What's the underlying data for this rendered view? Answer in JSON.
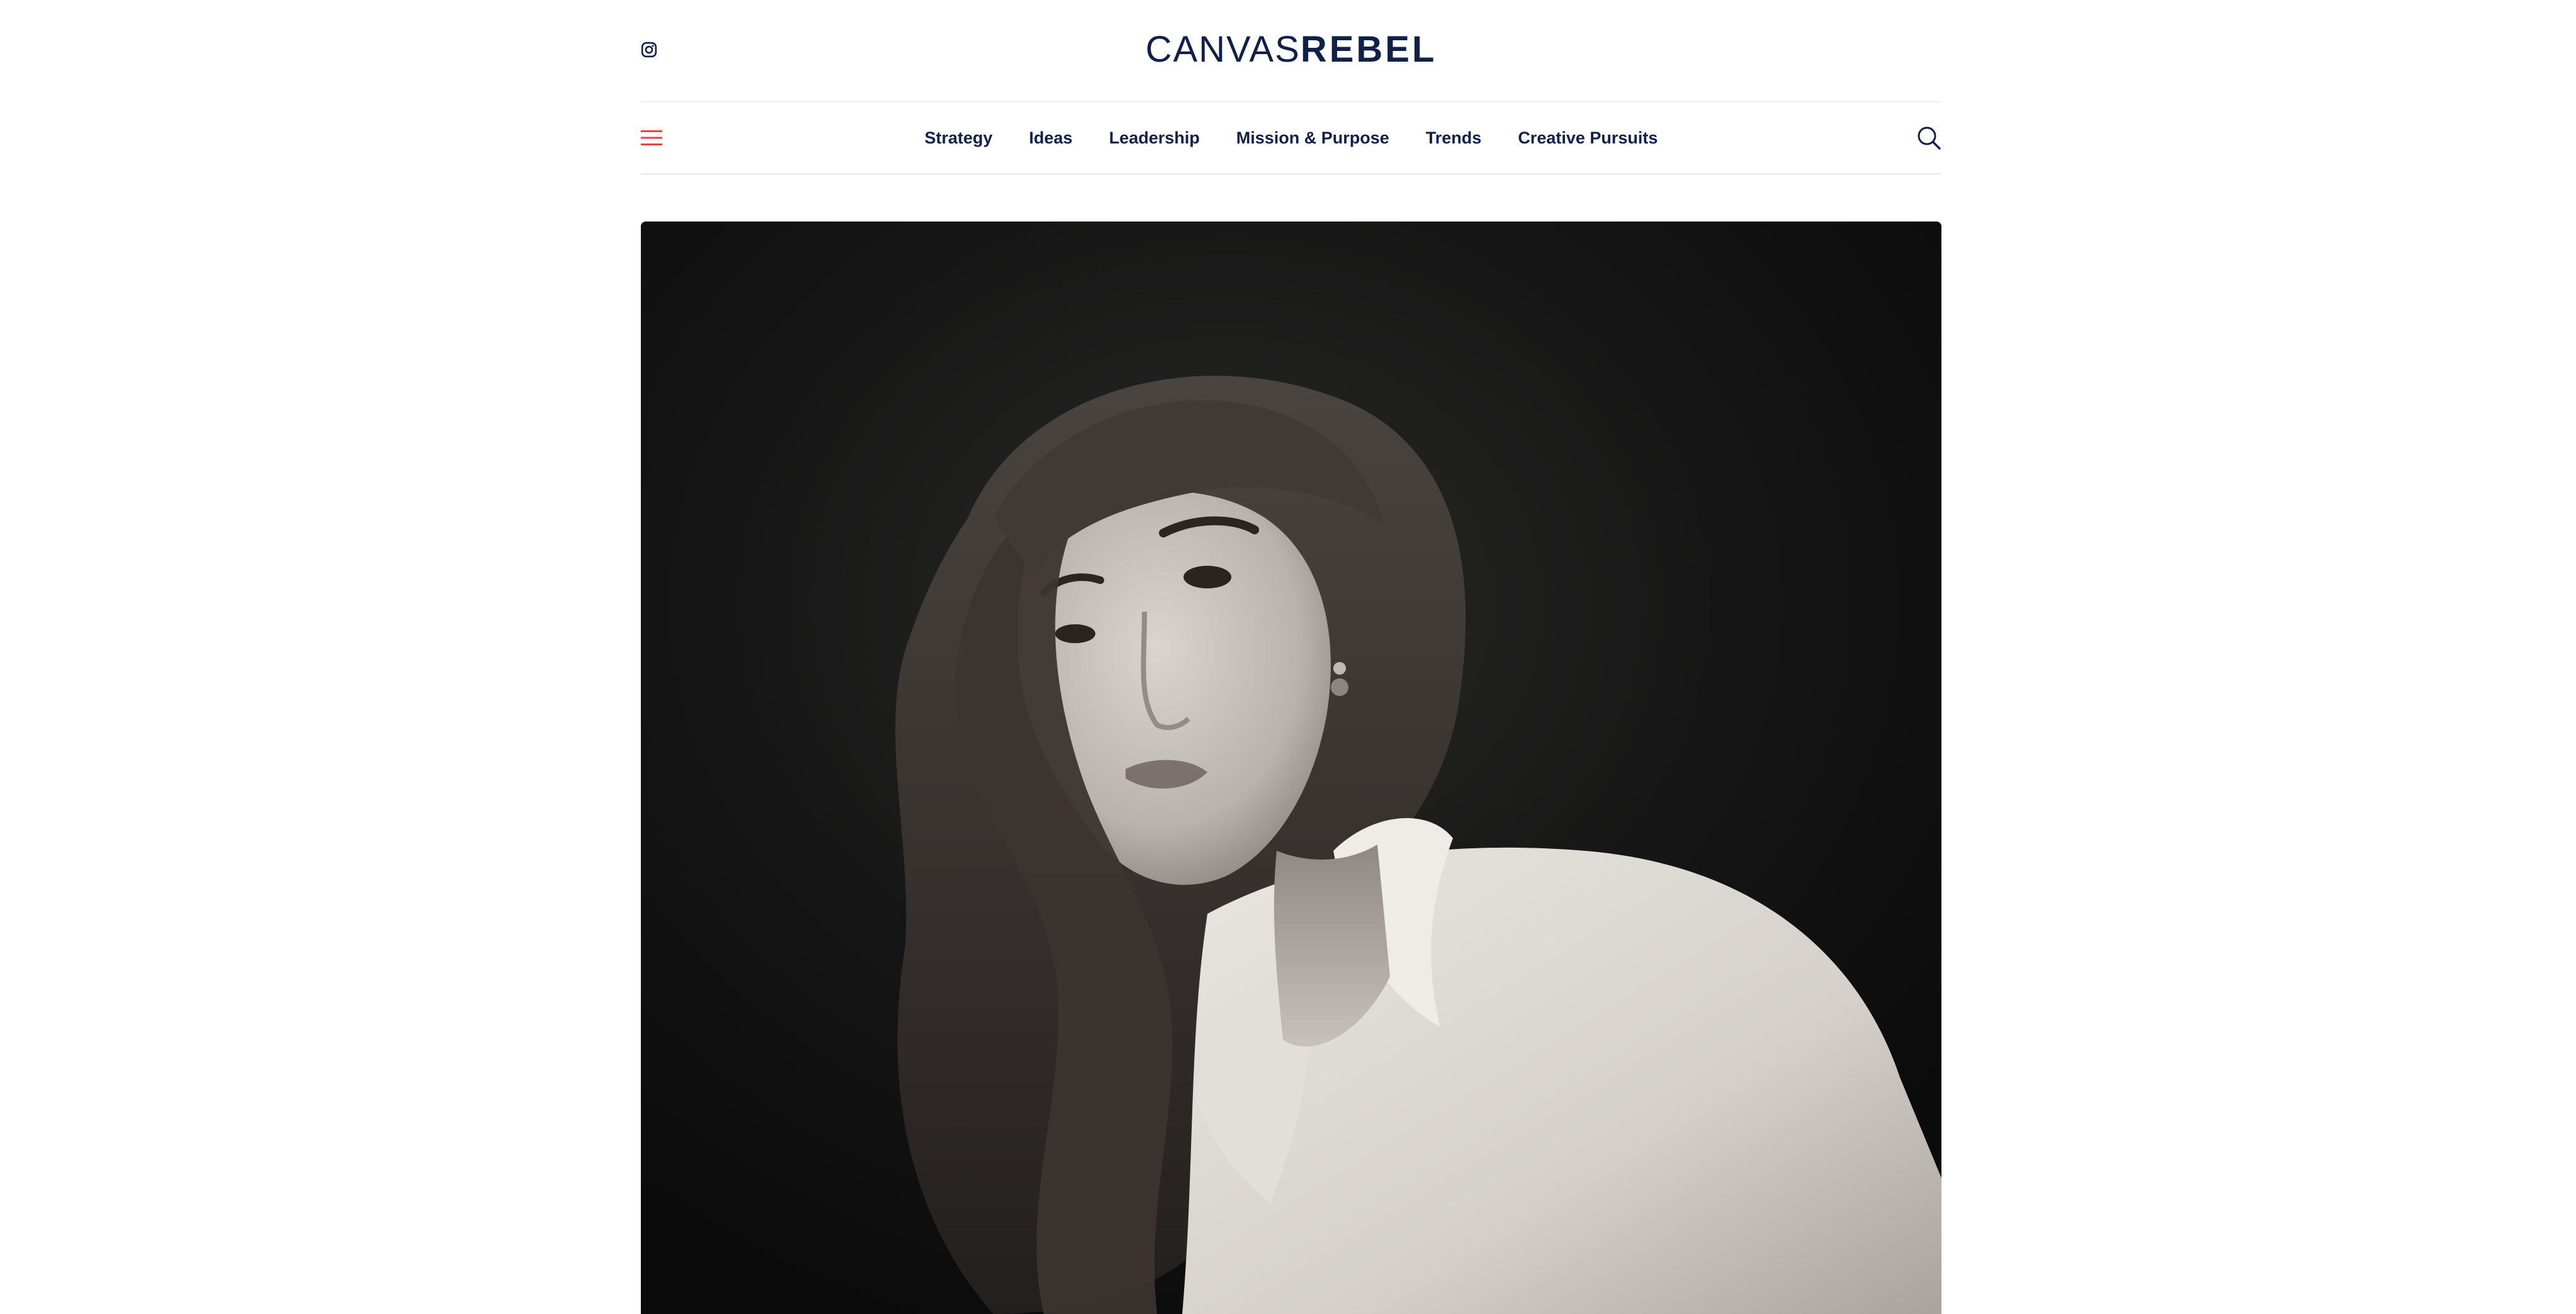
{
  "header": {
    "logo": {
      "light": "CANVAS",
      "bold": "REBEL"
    },
    "social_icon": "instagram-icon"
  },
  "nav": {
    "menu_icon": "hamburger-menu-icon",
    "items": [
      {
        "label": "Strategy"
      },
      {
        "label": "Ideas"
      },
      {
        "label": "Leadership"
      },
      {
        "label": "Mission & Purpose"
      },
      {
        "label": "Trends"
      },
      {
        "label": "Creative Pursuits"
      }
    ],
    "search_icon": "search-icon"
  },
  "colors": {
    "brand_navy": "#0f2148",
    "accent_red": "#e8434b",
    "photo_background": "#121212"
  },
  "hero": {
    "image": "black-and-white-portrait-photo"
  }
}
